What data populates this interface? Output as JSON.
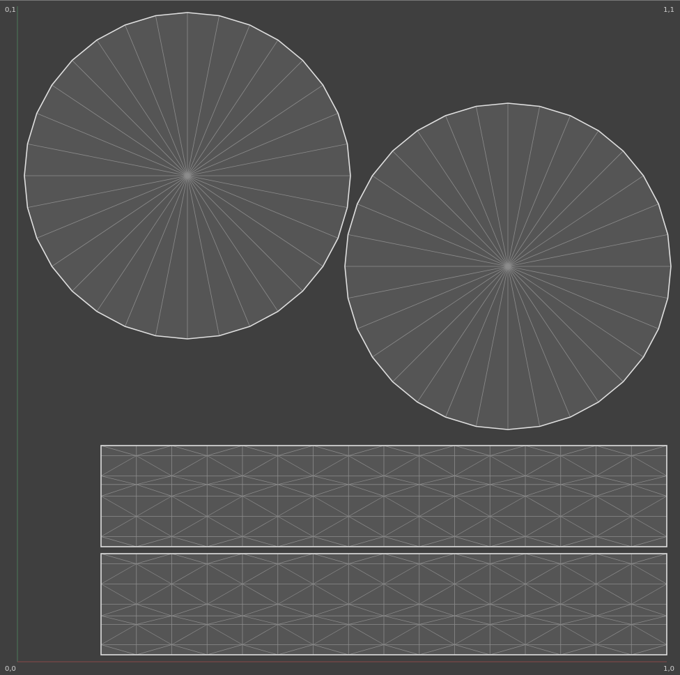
{
  "corner_labels": {
    "top_left": "0,1",
    "top_right": "1,1",
    "bottom_left": "0,0",
    "bottom_right": "1,0"
  },
  "colors": {
    "background": "#3f3f3f",
    "face": "#555555",
    "edge": "#8c8c8c",
    "boundary": "#e0e0e0",
    "v_axis": "#4e7a5a",
    "u_axis": "#8a4a4a"
  },
  "uv_islands": [
    {
      "type": "disc",
      "segments": 32
    },
    {
      "type": "disc",
      "segments": 32
    },
    {
      "type": "strip",
      "columns": 16
    },
    {
      "type": "strip",
      "columns": 16
    }
  ]
}
